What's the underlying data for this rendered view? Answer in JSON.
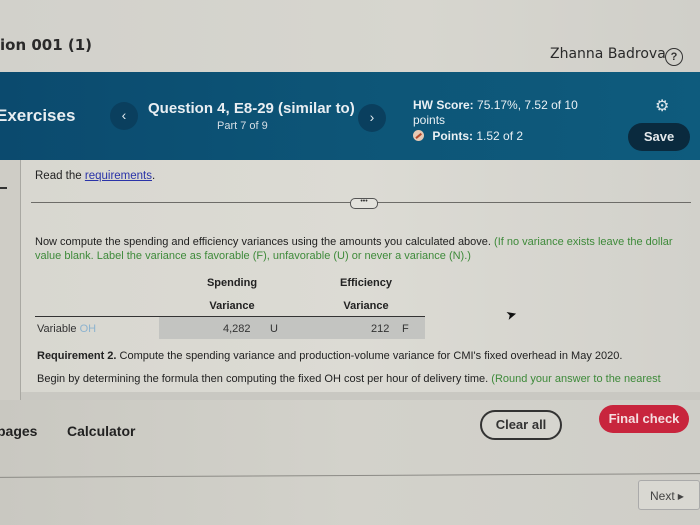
{
  "topbar": {
    "course_title": "ion 001 (1)",
    "user_name": "Zhanna Badrova",
    "help_icon": "?"
  },
  "header": {
    "section_label": "Exercises",
    "prev_icon": "‹",
    "next_icon": "›",
    "question_title": "Question 4, E8-29 (similar to)",
    "question_part": "Part 7 of 9",
    "hw_score_label": "HW Score:",
    "hw_score_value": "75.17%, 7.52 of 10 points",
    "points_label": "Points:",
    "points_value": "1.52 of 2",
    "gear_icon": "⚙",
    "save_label": "Save"
  },
  "content": {
    "read_prefix": "Read the ",
    "read_link": "requirements",
    "read_suffix": ".",
    "expand_label": "•••",
    "instruction_main": "Now compute the spending and efficiency variances using the amounts you calculated above. ",
    "instruction_hint": "(If no variance exists leave the dollar value blank. Label the variance as favorable (F), unfavorable (U) or never a variance (N).)",
    "table": {
      "headers": [
        {
          "line1": "Spending",
          "line2": "Variance"
        },
        {
          "line1": "Efficiency",
          "line2": "Variance"
        }
      ],
      "rows": [
        {
          "label_main": "Variable ",
          "label_faint": "OH",
          "spending_value": "4,282",
          "spending_label": "U",
          "efficiency_value": "212",
          "efficiency_label": "F"
        }
      ]
    },
    "requirement2_bold": "Requirement 2.",
    "requirement2_text": " Compute the spending variance and production-volume variance for CMI's fixed overhead in May 2020.",
    "begin_text": "Begin by determining the formula then computing the fixed OH cost per hour of delivery time. ",
    "begin_hint": "(Round your answer to the nearest"
  },
  "footer": {
    "pages_label": "pages",
    "calculator_label": "Calculator",
    "clear_all_label": "Clear all",
    "final_check_label": "Final check",
    "next_label": "Next",
    "next_icon": "▶"
  },
  "colors": {
    "header_bg": "#0d5577",
    "save_bg": "#0a2a3e",
    "final_check_bg": "#c8253d",
    "link": "#2a33a8",
    "hint_green": "#3e8a3a"
  }
}
